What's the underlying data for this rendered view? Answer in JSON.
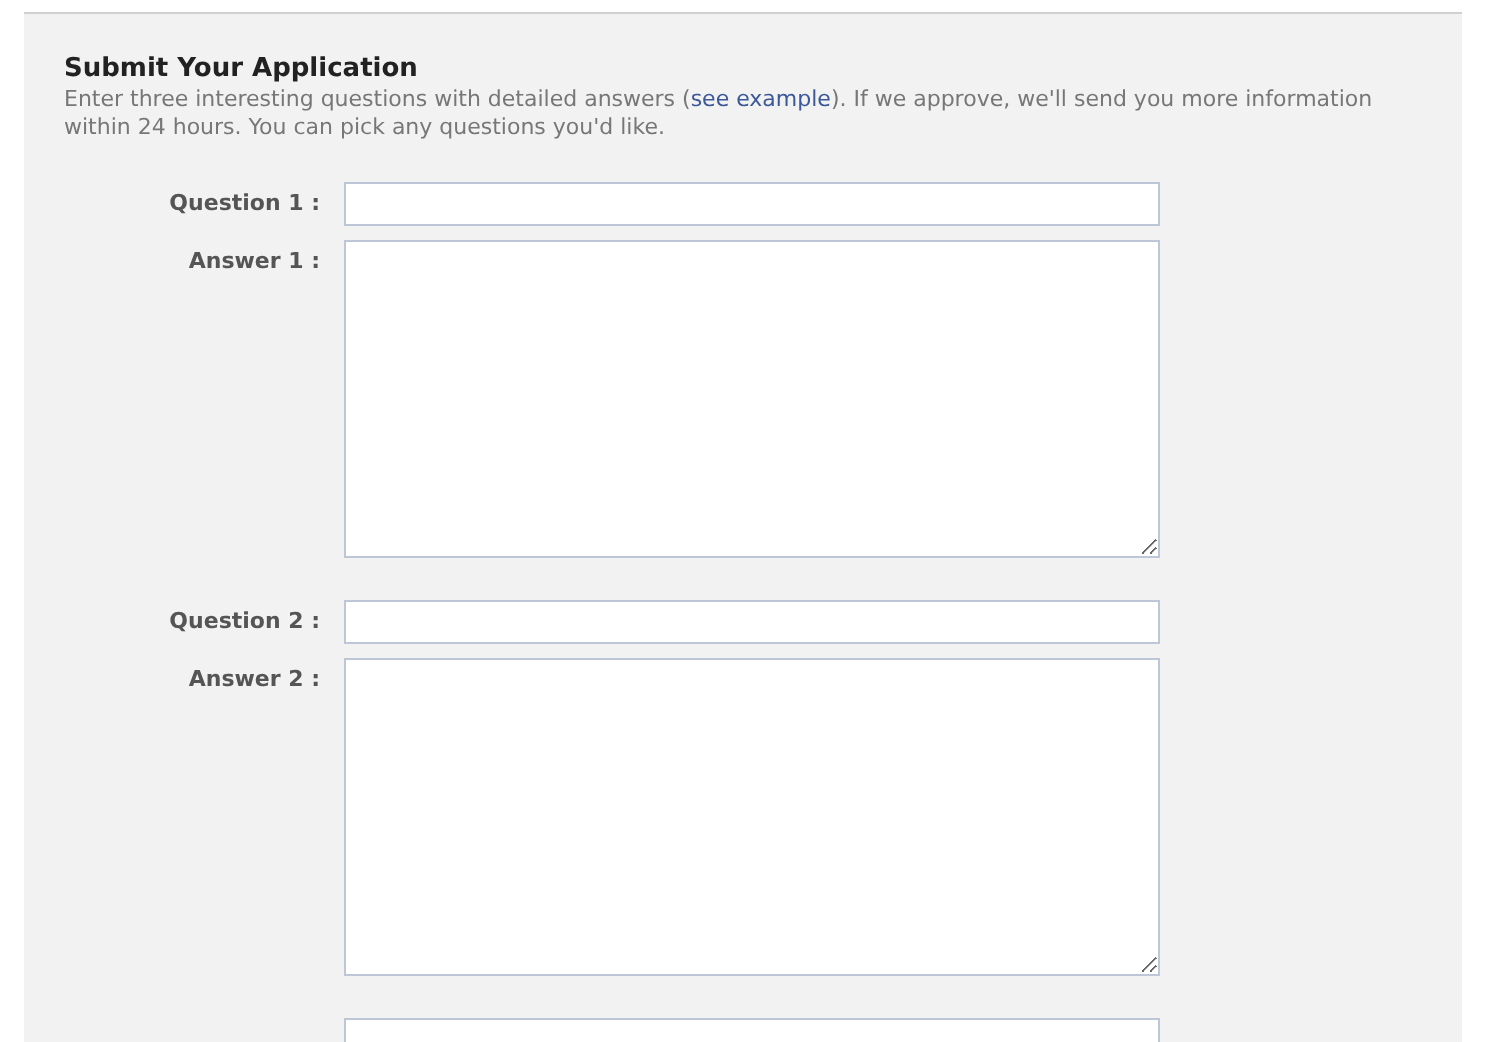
{
  "title": "Submit Your Application",
  "description": {
    "before": "Enter three interesting questions with detailed answers (",
    "link": "see example",
    "after": "). If we approve, we'll send you more information within 24 hours. You can pick any questions you'd like."
  },
  "fields": [
    {
      "kind": "question",
      "label": "Question 1 :"
    },
    {
      "kind": "answer",
      "label": "Answer 1 :"
    },
    {
      "kind": "question",
      "label": "Question 2 :"
    },
    {
      "kind": "answer",
      "label": "Answer 2 :"
    },
    {
      "kind": "question"
    }
  ]
}
